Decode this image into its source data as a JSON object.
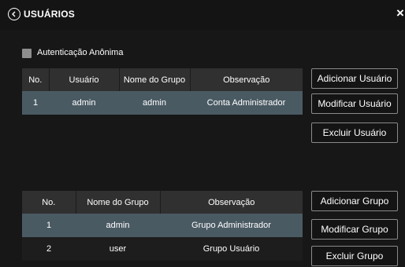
{
  "window": {
    "title": "USUÁRIOS",
    "close_glyph": "×"
  },
  "anonymous_auth": {
    "label": "Autenticação Anônima",
    "checked": false
  },
  "users_table": {
    "headers": [
      "No.",
      "Usuário",
      "Nome do Grupo",
      "Observação"
    ],
    "rows": [
      {
        "no": "1",
        "user": "admin",
        "group": "admin",
        "note": "Conta Administrador"
      }
    ]
  },
  "user_buttons": {
    "add": "Adicionar Usuário",
    "modify": "Modificar Usuário",
    "delete": "Excluir Usuário"
  },
  "groups_table": {
    "headers": [
      "No.",
      "Nome do Grupo",
      "Observação"
    ],
    "rows": [
      {
        "no": "1",
        "group": "admin",
        "note": "Grupo Administrador"
      },
      {
        "no": "2",
        "group": "user",
        "note": "Grupo Usuário"
      }
    ]
  },
  "group_buttons": {
    "add": "Adicionar Grupo",
    "modify": "Modificar Grupo",
    "delete": "Excluir Grupo"
  },
  "colors": {
    "selected_row": "#4a5a63",
    "header_row": "#303030",
    "background": "#171717",
    "button_border": "#8a8a8a"
  }
}
